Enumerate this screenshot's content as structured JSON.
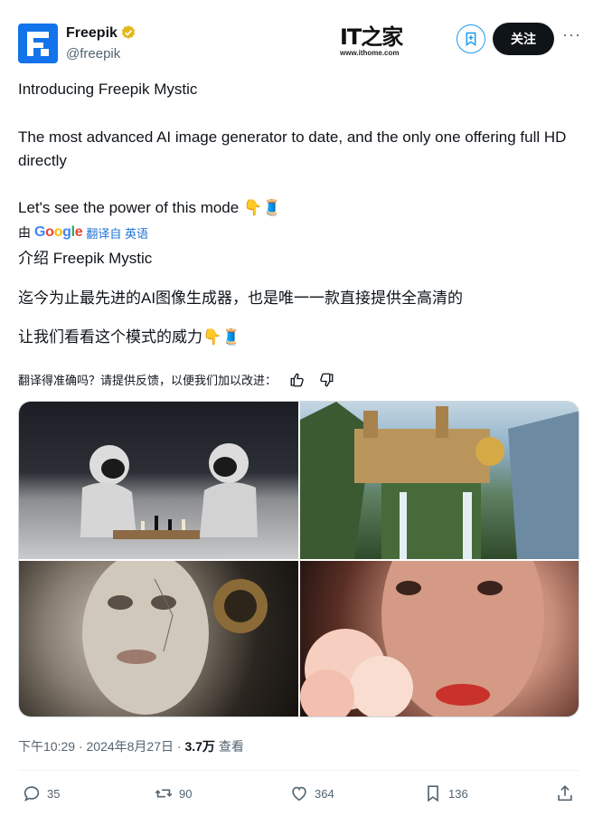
{
  "author": {
    "name": "Freepik",
    "handle": "@freepik"
  },
  "watermark": {
    "logo": "IT之家",
    "url": "www.ithome.com"
  },
  "header": {
    "follow_label": "关注",
    "more_label": "···"
  },
  "tweet": {
    "line1": "Introducing Freepik Mystic",
    "line2": "The most advanced AI image generator to date, and the only one offering full HD directly",
    "line3": "Let's see the power of this mode 👇🧵"
  },
  "translation": {
    "by": "由",
    "google_label": "Google",
    "from_label": "翻译自 英语",
    "line1": "介绍 Freepik Mystic",
    "line2": "迄今为止最先进的AI图像生成器，也是唯一一款直接提供全高清的",
    "line3": "让我们看看这个模式的威力👇🧵",
    "feedback": "翻译得准确吗？请提供反馈，以便我们加以改进："
  },
  "meta": {
    "time": "下午10:29",
    "date": "2024年8月27日",
    "views": "3.7万",
    "views_label": "查看",
    "sep": " · "
  },
  "actions": {
    "replies": "35",
    "retweets": "90",
    "likes": "364",
    "bookmarks": "136"
  },
  "colors": {
    "accent": "#1d9bf0",
    "brand": "#1273eb",
    "text": "#0f1419",
    "muted": "#536471"
  }
}
